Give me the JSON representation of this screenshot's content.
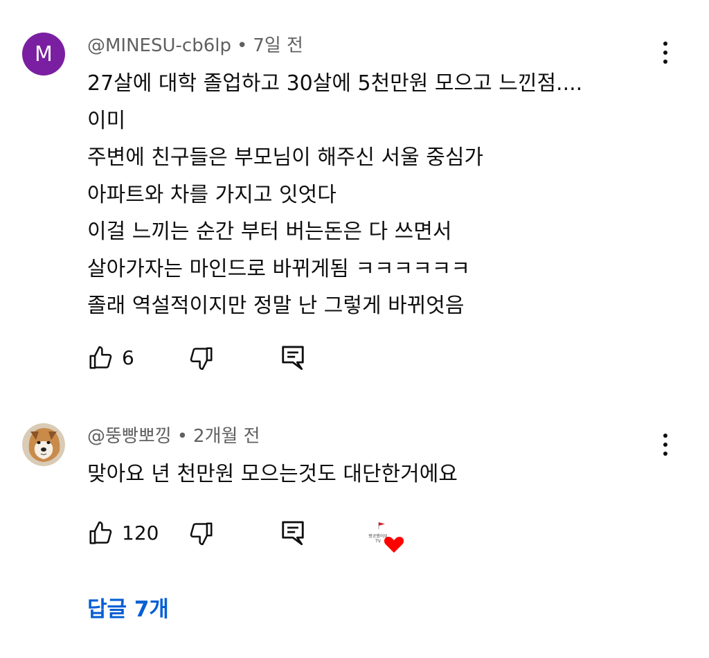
{
  "comments": [
    {
      "avatar_letter": "M",
      "avatar_color": "#7b1fa2",
      "author": "@MINESU-cb6lp",
      "time": "7일 전",
      "text": "27살에 대학 졸업하고 30살에 5천만원  모으고 느낀점....\n이미\n주변에 친구들은 부모님이 해주신 서울 중심가\n아파트와 차를 가지고 잇엇다\n이걸 느끼는 순간 부터 버는돈은 다 쓰면서\n살아가자는 마인드로 바뀌게됨 ㅋㅋㅋㅋㅋㅋ\n졸래 역설적이지만 정말 난 그렇게 바뀌엇음",
      "likes": "6",
      "icons": [
        "thumbs-up-icon",
        "thumbs-down-icon",
        "reply-icon",
        "more-vertical-icon"
      ]
    },
    {
      "avatar": "dog-photo",
      "author": "@뚱빵뽀낑",
      "time": "2개월 전",
      "text": "맞아요 년 천만원 모으는것도 대단한거에요",
      "likes": "120",
      "creator_heart_label": "짱공했어요 TV",
      "icons": [
        "thumbs-up-icon",
        "thumbs-down-icon",
        "reply-icon",
        "creator-heart-icon",
        "more-vertical-icon"
      ]
    }
  ],
  "replies_label": "답글 7개",
  "colors": {
    "text": "#0f0f0f",
    "meta": "#606060",
    "link": "#065fd4",
    "heart": "#ff0000"
  }
}
